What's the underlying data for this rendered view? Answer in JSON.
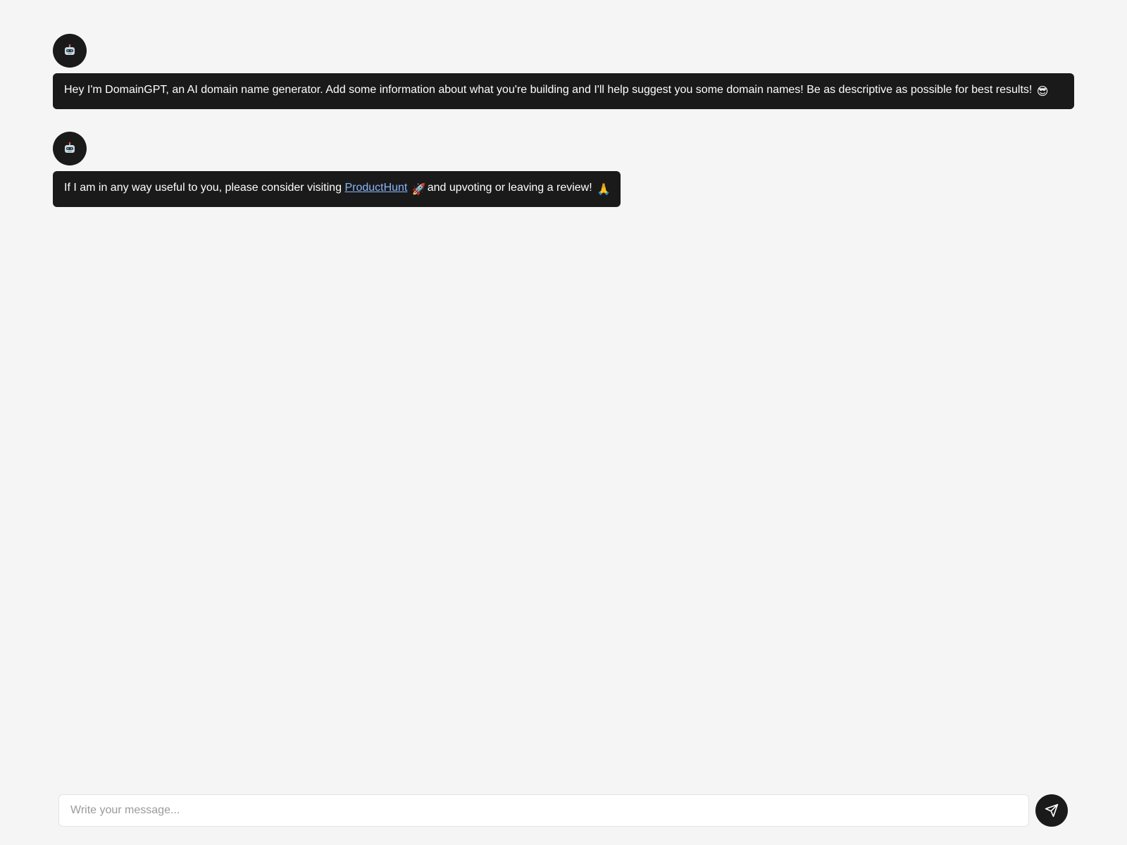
{
  "messages": [
    {
      "sender_icon": "robot-icon",
      "text": "Hey I'm DomainGPT, an AI domain name generator. Add some information about what you're building and I'll help suggest you some domain names! Be as descriptive as possible for best results!",
      "emoji": "😎"
    },
    {
      "sender_icon": "robot-icon",
      "text_before_link": "If I am in any way useful to you, please consider visiting",
      "link_text": "ProductHunt",
      "emoji_after_link": "🚀",
      "text_after_link": "and upvoting or leaving a review!",
      "emoji": "🙏"
    }
  ],
  "composer": {
    "placeholder": "Write your message...",
    "value": "",
    "send_icon": "send-icon"
  },
  "colors": {
    "background": "#f5f5f5",
    "bubble": "#1a1a1a",
    "link": "#8ab4f8"
  }
}
